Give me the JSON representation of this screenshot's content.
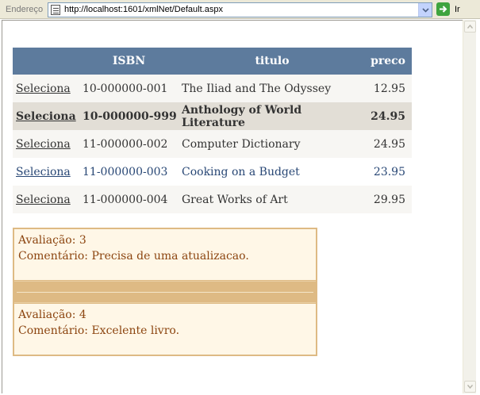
{
  "browser": {
    "address_label": "Endereço",
    "url": "http://localhost:1601/xmlNet/Default.aspx",
    "go_label": "Ir"
  },
  "grid": {
    "headers": [
      "",
      "ISBN",
      "titulo",
      "preco"
    ],
    "select_label": "Seleciona",
    "selected_index": 1,
    "rows": [
      {
        "isbn": "10-000000-001",
        "titulo": "The Iliad and The Odyssey",
        "preco": "12.95"
      },
      {
        "isbn": "10-000000-999",
        "titulo": "Anthology of World Literature",
        "preco": "24.95"
      },
      {
        "isbn": "11-000000-002",
        "titulo": "Computer Dictionary",
        "preco": "24.95"
      },
      {
        "isbn": "11-000000-003",
        "titulo": "Cooking on a Budget",
        "preco": "23.95"
      },
      {
        "isbn": "11-000000-004",
        "titulo": "Great Works of Art",
        "preco": "29.95"
      }
    ]
  },
  "reviews": {
    "items": [
      {
        "avaliacao": "Avaliação: 3",
        "comentario": "Comentário: Precisa de uma atualizacao."
      },
      {
        "avaliacao": "Avaliação: 4",
        "comentario": "Comentário: Excelente livro."
      }
    ]
  },
  "colors": {
    "header_bg": "#5d7b9d",
    "row_alt_bg": "#f7f6f3",
    "selected_bg": "#e2ded6",
    "review_border": "#deba84",
    "review_text": "#8c4510"
  }
}
